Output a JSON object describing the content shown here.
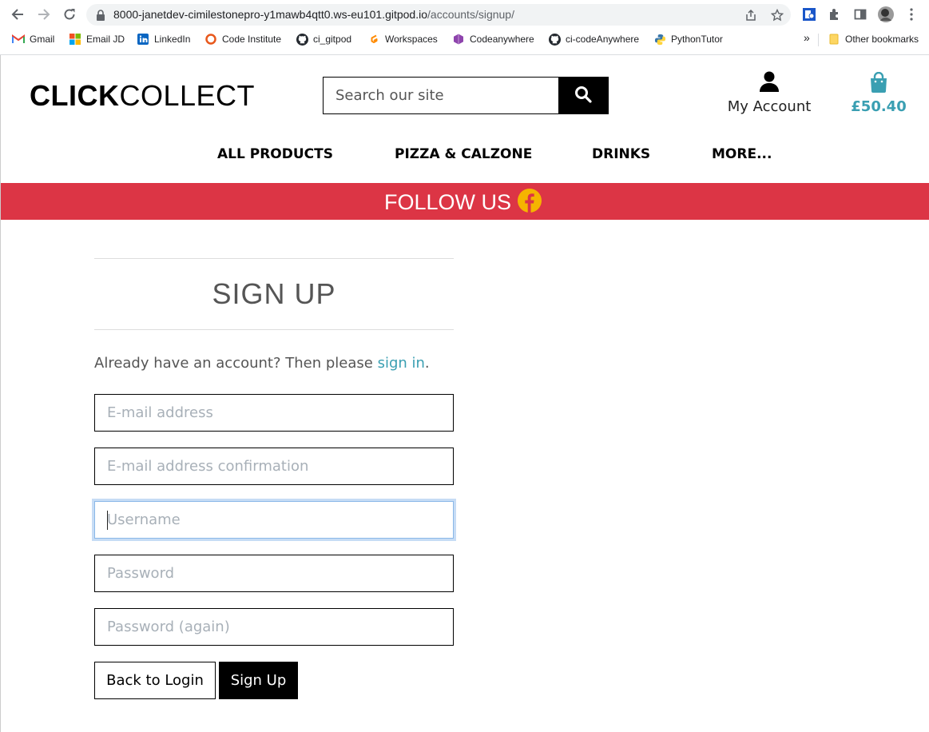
{
  "browser": {
    "url_host": "8000-janetdev-cimilestonepro-y1mawb4qtt0.ws-eu101.gitpod.io",
    "url_path": "/accounts/signup/",
    "bookmarks": [
      {
        "label": "Gmail",
        "icon": "gmail-icon"
      },
      {
        "label": "Email JD",
        "icon": "microsoft-icon"
      },
      {
        "label": "LinkedIn",
        "icon": "linkedin-icon"
      },
      {
        "label": "Code Institute",
        "icon": "code-institute-icon"
      },
      {
        "label": "ci_gitpod",
        "icon": "github-icon"
      },
      {
        "label": "Workspaces",
        "icon": "gitpod-icon"
      },
      {
        "label": "Codeanywhere",
        "icon": "codeanywhere-icon"
      },
      {
        "label": "ci-codeAnywhere",
        "icon": "github-icon"
      },
      {
        "label": "PythonTutor",
        "icon": "python-icon"
      }
    ],
    "overflow": "»",
    "other_bookmarks": "Other bookmarks"
  },
  "header": {
    "logo_bold": "CLICK",
    "logo_light": "COLLECT",
    "search_placeholder": "Search our site",
    "account_label": "My Account",
    "basket_total": "£50.40"
  },
  "nav": {
    "items": [
      "ALL PRODUCTS",
      "PIZZA & CALZONE",
      "DRINKS",
      "MORE..."
    ]
  },
  "banner": {
    "text": "FOLLOW US"
  },
  "signup": {
    "title": "SIGN UP",
    "already_text": "Already have an account? Then please ",
    "signin_link": "sign in",
    "period": ".",
    "fields": {
      "email": "E-mail address",
      "email_confirm": "E-mail address confirmation",
      "username": "Username",
      "password": "Password",
      "password_again": "Password (again)"
    },
    "back_button": "Back to Login",
    "submit_button": "Sign Up"
  },
  "colors": {
    "accent": "#3a9fb2",
    "banner": "#dc3545",
    "facebook_icon": "#f5b400"
  }
}
